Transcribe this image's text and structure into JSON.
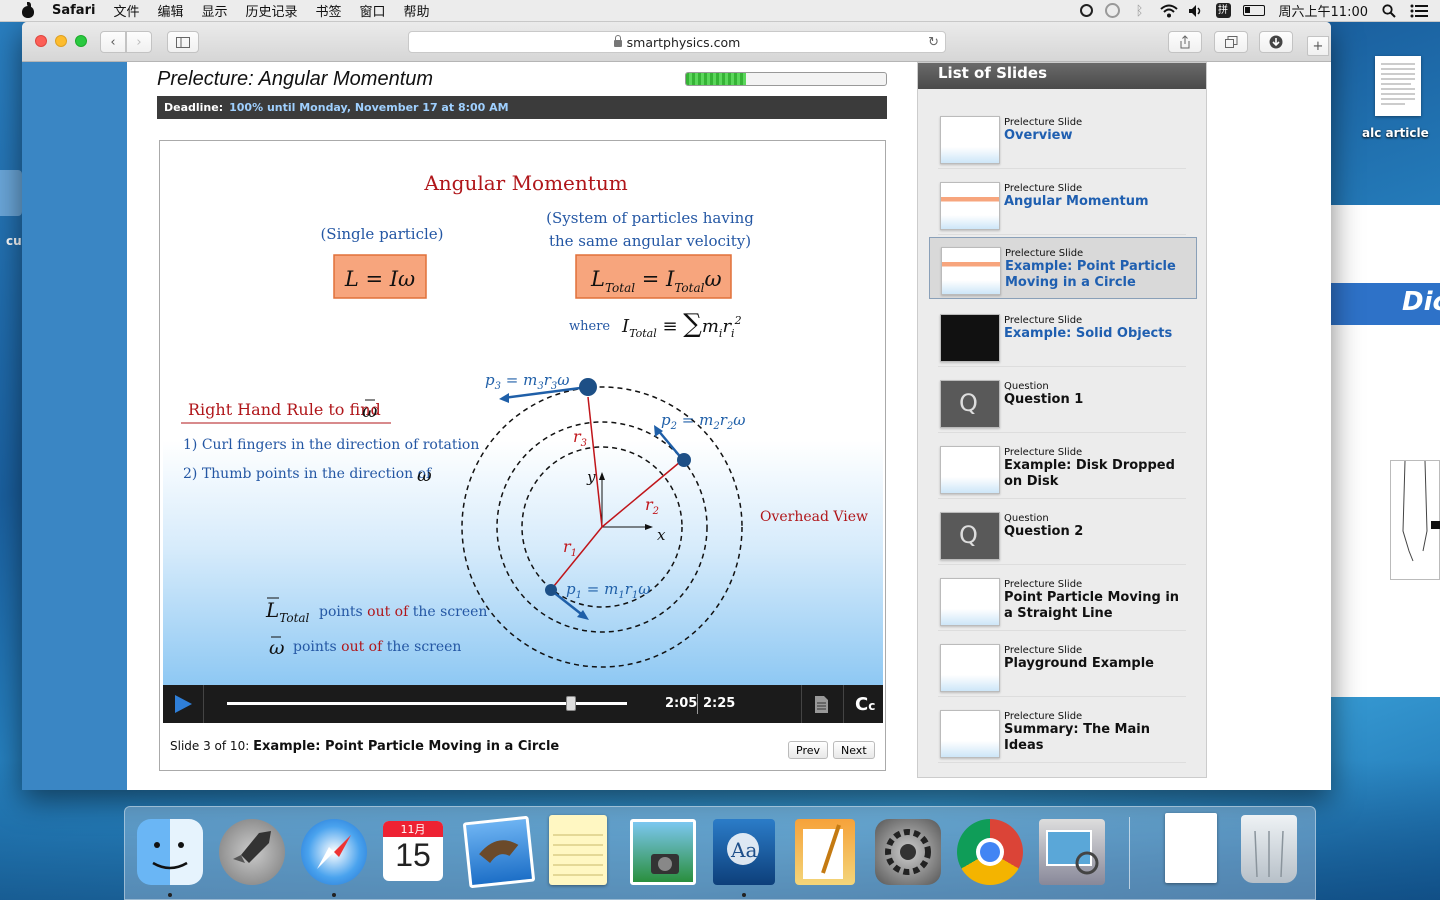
{
  "menubar": {
    "app": "Safari",
    "menus": [
      "文件",
      "编辑",
      "显示",
      "历史记录",
      "书签",
      "窗口",
      "帮助"
    ],
    "clock": "周六上午11:00"
  },
  "browser": {
    "url": "smartphysics.com"
  },
  "lecture": {
    "title": "Prelecture: Angular Momentum",
    "progress_fraction": 0.3,
    "deadline_label": "Deadline:",
    "deadline_value": "100% until Monday, November 17 at 8:00 AM"
  },
  "slide": {
    "heading": "Angular Momentum",
    "single_particle": "(Single particle)",
    "system_line1": "(System of particles having",
    "system_line2": "the same angular velocity)",
    "eq_single": "L = Iω",
    "eq_total_L": "L",
    "eq_total_sub1": "Total",
    "eq_total_mid": " = I",
    "eq_total_sub2": "Total",
    "eq_total_end": "ω",
    "where": "where",
    "rhr_title": "Right Hand Rule to find",
    "rhr_step1": "1) Curl fingers in the direction of rotation",
    "rhr_step2": "2) Thumb points in the direction of",
    "overhead": "Overhead View",
    "ltotal_text_a": "points",
    "ltotal_text_b": "out of",
    "ltotal_text_c": "the screen",
    "omega_text_a": "points",
    "omega_text_b": "out of",
    "omega_text_c": "the screen"
  },
  "player": {
    "elapsed": "2:05",
    "duration": "2:25",
    "progress_fraction": 0.86,
    "cc_label": "C"
  },
  "footer": {
    "slide_info": "Slide 3 of 10:",
    "slide_title": "Example: Point Particle Moving in a Circle",
    "prev": "Prev",
    "next": "Next"
  },
  "sidebar": {
    "title": "List of Slides",
    "items": [
      {
        "kind": "Prelecture Slide",
        "name": "Overview",
        "blue": true
      },
      {
        "kind": "Prelecture Slide",
        "name": "Angular Momentum",
        "blue": true
      },
      {
        "kind": "Prelecture Slide",
        "name": "Example: Point Particle Moving in a Circle",
        "blue": true
      },
      {
        "kind": "Prelecture Slide",
        "name": "Example: Solid Objects",
        "blue": true
      },
      {
        "kind": "Question",
        "name": "Question 1",
        "blue": false
      },
      {
        "kind": "Prelecture Slide",
        "name": "Example: Disk Dropped on Disk",
        "blue": false
      },
      {
        "kind": "Question",
        "name": "Question 2",
        "blue": false
      },
      {
        "kind": "Prelecture Slide",
        "name": "Point Particle Moving in a Straight Line",
        "blue": false
      },
      {
        "kind": "Prelecture Slide",
        "name": "Playground Example",
        "blue": false
      },
      {
        "kind": "Prelecture Slide",
        "name": "Summary: The Main Ideas",
        "blue": false
      }
    ]
  },
  "desktop": {
    "file_label": "alc article",
    "bg_window_text": "Dic",
    "cut_label": "cu"
  },
  "dock": {
    "calendar_month": "11月",
    "calendar_day": "15"
  }
}
